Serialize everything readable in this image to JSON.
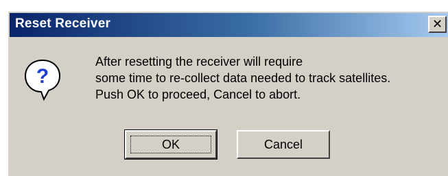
{
  "window": {
    "title": "Reset Receiver",
    "close_glyph": "✕"
  },
  "icon": "question-icon",
  "message": {
    "lines": [
      "After resetting the receiver will require",
      "some time to re-collect data needed to track satellites.",
      "Push OK to proceed, Cancel to abort."
    ]
  },
  "buttons": {
    "ok_label": "OK",
    "cancel_label": "Cancel"
  },
  "colors": {
    "title_start": "#0a246a",
    "title_end": "#a6caf0",
    "dialog_bg": "#d4d0c8"
  }
}
